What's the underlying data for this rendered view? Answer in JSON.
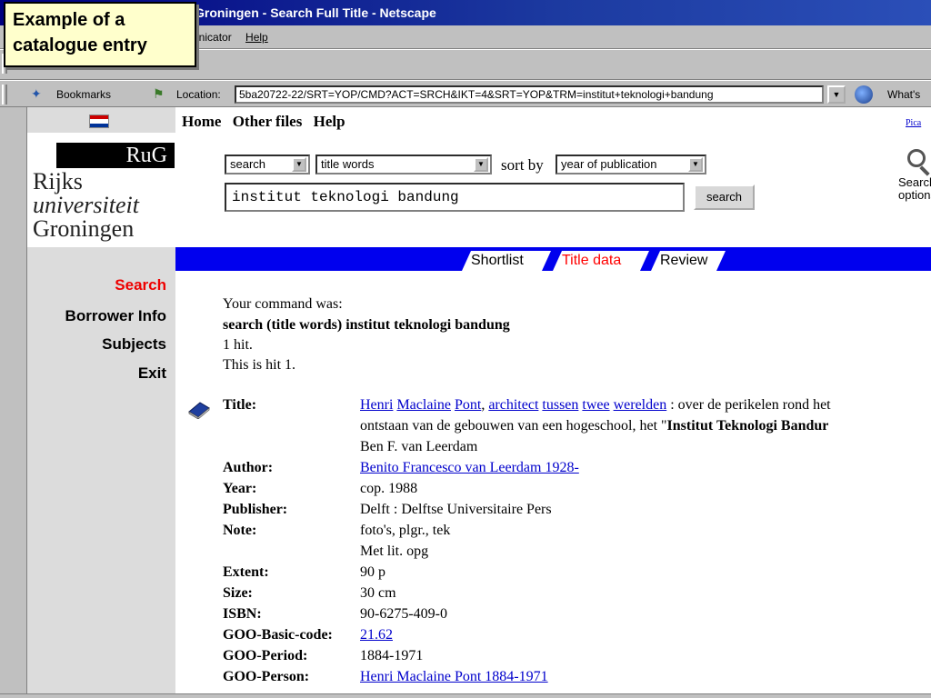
{
  "callout": {
    "text": "Example of a catalogue entry"
  },
  "window": {
    "title": "Groningen - Search Full Title - Netscape"
  },
  "menu": {
    "items": [
      "unicator",
      "Help"
    ]
  },
  "location_bar": {
    "bookmarks_label": "Bookmarks",
    "location_label": "Location:",
    "url": "5ba20722-22/SRT=YOP/CMD?ACT=SRCH&IKT=4&SRT=YOP&TRM=institut+teknologi+bandung",
    "whats_label": "What's"
  },
  "colors": {
    "flag_top": "#cc0000",
    "flag_mid": "#ffffff",
    "flag_bottom": "#003399",
    "blue_bar": "#0000ee",
    "active_red": "#ee0000"
  },
  "topnav": {
    "home": "Home",
    "other_files": "Other files",
    "help": "Help",
    "pica": "Pica"
  },
  "logo": {
    "short": "RuG",
    "line1": "Rijks",
    "line2": "universiteit",
    "line3": "Groningen"
  },
  "search_form": {
    "action": "search",
    "field": "title words",
    "sort_label": "sort by",
    "sort": "year of publication",
    "query": "institut teknologi bandung",
    "button": "search",
    "options_label": "Search options"
  },
  "tabs": [
    {
      "label": "Shortlist",
      "active": false
    },
    {
      "label": "Title data",
      "active": true
    },
    {
      "label": "Review",
      "active": false
    }
  ],
  "sidenav": [
    {
      "label": "Search",
      "active": true
    },
    {
      "label": "Borrower Info",
      "active": false
    },
    {
      "label": "Subjects",
      "active": false
    },
    {
      "label": "Exit",
      "active": false
    }
  ],
  "result": {
    "command_label": "Your command was:",
    "command": "search (title words) institut teknologi bandung",
    "hits": "1 hit.",
    "current_hit": "This is hit 1."
  },
  "record": {
    "title_label": "Title:",
    "title_link_words": [
      "Henri",
      "Maclaine",
      "Pont",
      "architect",
      "tussen",
      "twee",
      "werelden"
    ],
    "title_rest": ": over de perikelen rond het",
    "title_line2_pre": "ontstaan van de gebouwen van een hogeschool, het \"",
    "title_line2_bold": "Institut Teknologi Bandur",
    "title_line3": "Ben F. van Leerdam",
    "author_label": "Author:",
    "author": "Benito Francesco van Leerdam 1928-",
    "year_label": "Year:",
    "year": "cop. 1988",
    "publisher_label": "Publisher:",
    "publisher": "Delft : Delftse Universitaire Pers",
    "note_label": "Note:",
    "note_1": "foto's, plgr., tek",
    "note_2": "Met lit. opg",
    "extent_label": "Extent:",
    "extent": "90 p",
    "size_label": "Size:",
    "size": "30 cm",
    "isbn_label": "ISBN:",
    "isbn": "90-6275-409-0",
    "goo_basic_label": "GOO-Basic-code:",
    "goo_basic": "21.62",
    "goo_period_label": "GOO-Period:",
    "goo_period": "1884-1971",
    "goo_person_label": "GOO-Person:",
    "goo_person": "Henri Maclaine Pont 1884-1971"
  }
}
